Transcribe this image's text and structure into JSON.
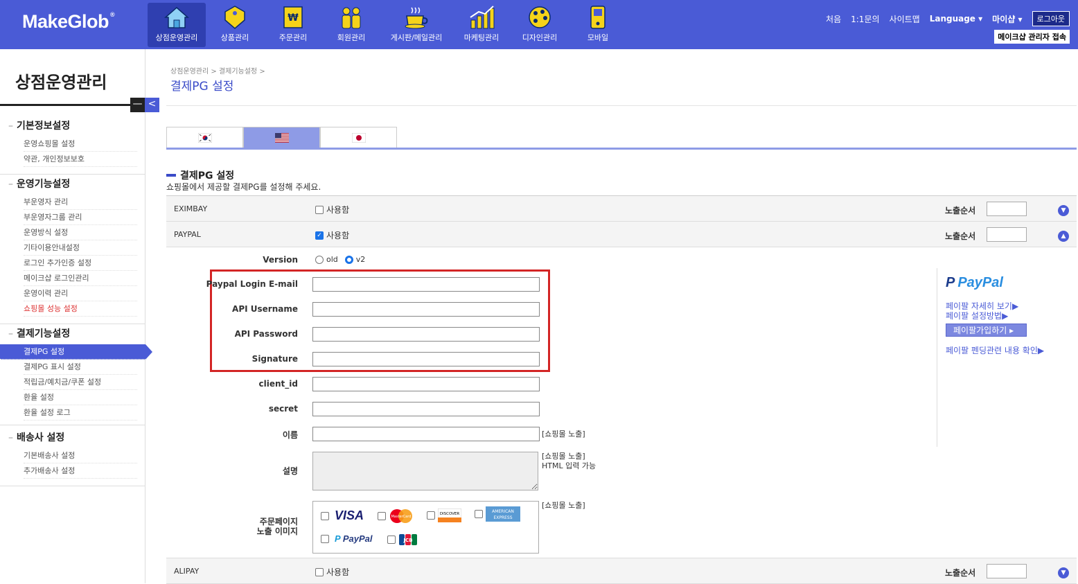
{
  "brand": {
    "name": "MakeGlob",
    "mark": "®"
  },
  "nav": [
    {
      "label": "상점운영관리",
      "icon": "house-icon",
      "active": true
    },
    {
      "label": "상품관리",
      "icon": "tag-icon",
      "active": false
    },
    {
      "label": "주문관리",
      "icon": "won-receipt-icon",
      "active": false
    },
    {
      "label": "회원관리",
      "icon": "people-icon",
      "active": false
    },
    {
      "label": "게시판/메일관리",
      "icon": "coffee-cup-icon",
      "active": false
    },
    {
      "label": "마케팅관리",
      "icon": "bar-chart-icon",
      "active": false
    },
    {
      "label": "디자인관리",
      "icon": "palette-icon",
      "active": false
    },
    {
      "label": "모바일",
      "icon": "mobile-icon",
      "active": false
    }
  ],
  "top_links": {
    "home": "처음",
    "inquiry": "1:1문의",
    "sitemap": "사이트맵",
    "language": "Language",
    "myshop": "마이샵",
    "logout": "로그아웃",
    "admin_access": "메이크샵 관리자 접속"
  },
  "sidebar": {
    "title": "상점운영관리",
    "toggle_minus": "—",
    "toggle_arrow": "<",
    "groups": [
      {
        "title": "기본정보설정",
        "items": [
          "운영쇼핑몰 설정",
          "약관, 개인정보보호"
        ]
      },
      {
        "title": "운영기능설정",
        "items": [
          "부운영자 관리",
          "부운영자그룹 관리",
          "운영방식 설정",
          "기타이용안내설정",
          "로그인 추가인증 설정",
          "메이크샵 로그인관리",
          "운영이력 관리",
          "쇼핑몰 성능 설정"
        ]
      },
      {
        "title": "결제기능설정",
        "items": [
          "결제PG 설정",
          "결제PG 표시 설정",
          "적립금/예치금/쿠폰 설정",
          "환율 설정",
          "환율 설정 로그"
        ]
      },
      {
        "title": "배송사 설정",
        "items": [
          "기본배송사 설정",
          "추가배송사 설정"
        ]
      }
    ]
  },
  "breadcrumb": "상점운영관리 > 결제기능설정 >",
  "page_title": "결제PG 설정",
  "tabs": [
    {
      "flag": "korea-flag-icon",
      "active": false
    },
    {
      "flag": "usa-flag-icon",
      "active": true
    },
    {
      "flag": "japan-flag-icon",
      "active": false
    }
  ],
  "section": {
    "title": "결제PG 설정",
    "desc": "쇼핑몰에서 제공할 결제PG를 설정해 주세요."
  },
  "pg_rows": {
    "eximbay": {
      "name": "EXIMBAY",
      "use_label": "사용함",
      "checked": false,
      "order_label": "노출순서",
      "order_value": ""
    },
    "paypal": {
      "name": "PAYPAL",
      "use_label": "사용함",
      "checked": true,
      "order_label": "노출순서",
      "order_value": ""
    },
    "alipay": {
      "name": "ALIPAY",
      "use_label": "사용함",
      "checked": false,
      "order_label": "노출순서",
      "order_value": ""
    }
  },
  "paypal_form": {
    "version_label": "Version",
    "version_old": "old",
    "version_v2": "v2",
    "email_label": "Paypal Login E-mail",
    "api_username_label": "API Username",
    "api_password_label": "API Password",
    "signature_label": "Signature",
    "client_id_label": "client_id",
    "secret_label": "secret",
    "name_label": "이름",
    "name_note": "[쇼핑몰 노출]",
    "desc_label": "설명",
    "desc_note1": "[쇼핑몰 노출]",
    "desc_note2": "HTML 입력 가능",
    "image_label1": "주문페이지",
    "image_label2": "노출 이미지",
    "image_note": "[쇼핑몰 노출]",
    "cards": {
      "visa": "VISA",
      "mastercard": "MasterCard",
      "discover": "DISCOVER",
      "amex1": "AMERICAN",
      "amex2": "EXPRESS",
      "paypal": "PayPal",
      "jcb": "JCB"
    }
  },
  "paypal_panel": {
    "logo": "PayPal",
    "detail_link": "페이팔 자세히 보기▶",
    "setup_link": "페이팔 설정방법▶",
    "join_button": "페이팔가입하기 ▸",
    "pending_link": "페이팔 펜딩관련 내용 확인▶"
  },
  "colors": {
    "brand": "#4a5bd6",
    "nav_active": "#2f3fb0",
    "highlight_box": "#d32525"
  }
}
